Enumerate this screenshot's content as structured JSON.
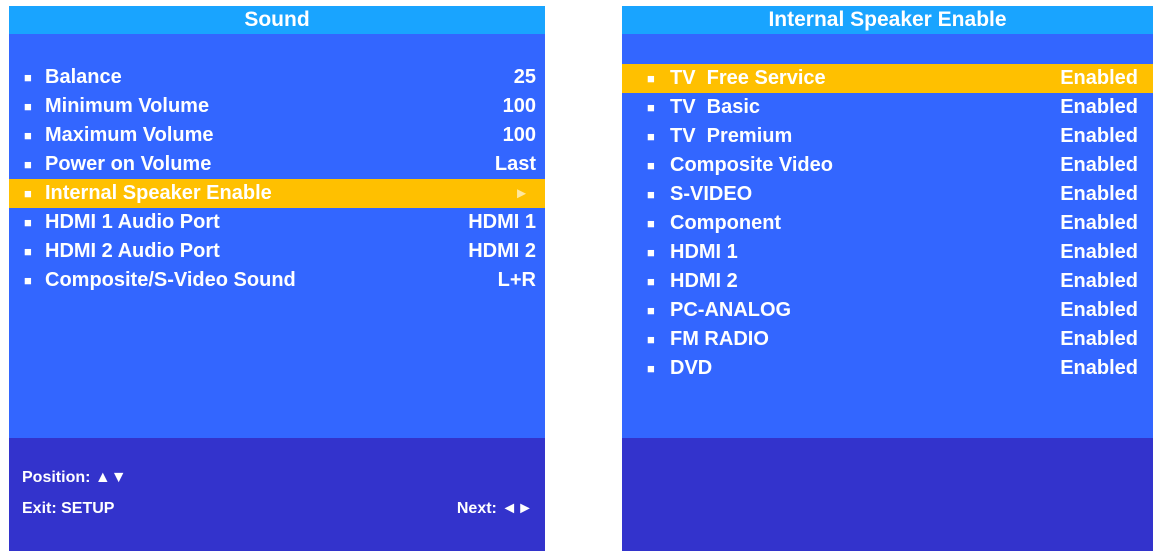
{
  "sound_panel": {
    "title": "Sound",
    "items": [
      {
        "label": "Balance",
        "value": "25"
      },
      {
        "label": "Minimum Volume",
        "value": "100"
      },
      {
        "label": "Maximum Volume",
        "value": "100"
      },
      {
        "label": "Power on Volume",
        "value": "Last"
      },
      {
        "label": "Internal Speaker Enable",
        "value": "►",
        "selected": true
      },
      {
        "label": "HDMI 1 Audio Port",
        "value": "HDMI 1"
      },
      {
        "label": "HDMI 2 Audio Port",
        "value": "HDMI 2"
      },
      {
        "label": "Composite/S-Video Sound",
        "value": "L+R"
      }
    ],
    "footer": {
      "position_label": "Position:",
      "position_glyphs": "▲▼",
      "exit_label": "Exit: SETUP",
      "next_label": "Next:",
      "next_glyphs": "◄►"
    }
  },
  "speaker_panel": {
    "title": "Internal Speaker Enable",
    "items": [
      {
        "label": "TV  Free Service",
        "value": "Enabled",
        "selected": true
      },
      {
        "label": "TV  Basic",
        "value": "Enabled"
      },
      {
        "label": "TV  Premium",
        "value": "Enabled"
      },
      {
        "label": "Composite Video",
        "value": "Enabled"
      },
      {
        "label": "S-VIDEO",
        "value": "Enabled"
      },
      {
        "label": "Component",
        "value": "Enabled"
      },
      {
        "label": "HDMI 1",
        "value": "Enabled"
      },
      {
        "label": "HDMI 2",
        "value": "Enabled"
      },
      {
        "label": "PC-ANALOG",
        "value": "Enabled"
      },
      {
        "label": "FM RADIO",
        "value": "Enabled"
      },
      {
        "label": "DVD",
        "value": "Enabled"
      }
    ]
  },
  "bullet_glyph": "■",
  "colors": {
    "panel": "#3366ff",
    "title_bar": "#19a4ff",
    "selected": "#ffc000",
    "footer": "#3333cc",
    "text": "#ffffff"
  }
}
